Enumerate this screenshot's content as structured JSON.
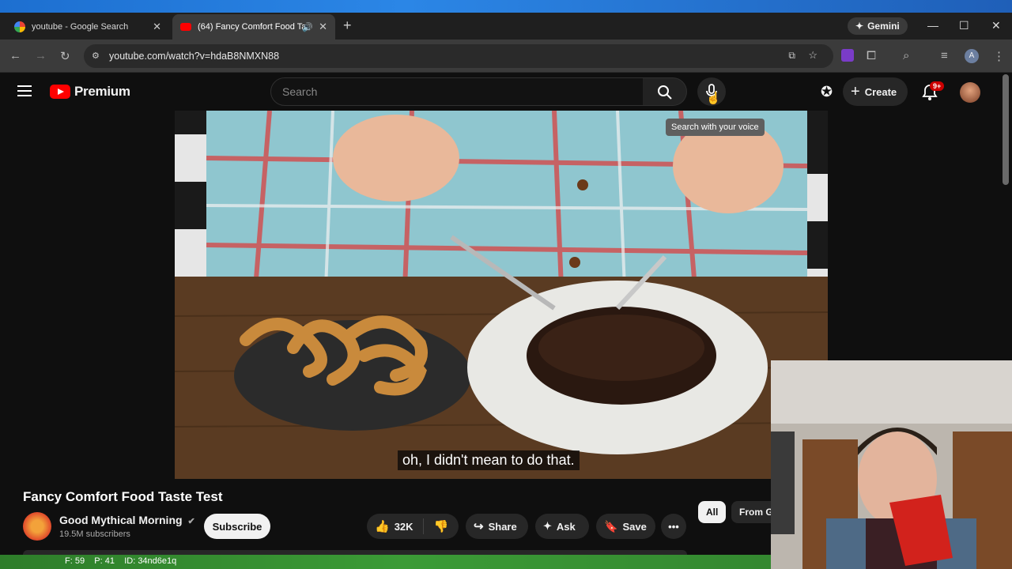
{
  "browser": {
    "tabs": [
      {
        "title": "youtube - Google Search",
        "active": false
      },
      {
        "title": "(64) Fancy Comfort Food Ta",
        "active": true
      }
    ],
    "gemini_label": "Gemini",
    "url": "youtube.com/watch?v=hdaB8NMXN88",
    "profile_initial": "A"
  },
  "youtube": {
    "logo_text": "Premium",
    "search_placeholder": "Search",
    "mic_tooltip": "Search with your voice",
    "create_label": "Create",
    "notification_count": "9+",
    "video": {
      "subtitle": "oh, I didn't mean to do that.",
      "title": "Fancy Comfort Food Taste Test"
    },
    "channel": {
      "name": "Good Mythical Morning",
      "subscribers": "19.5M subscribers",
      "subscribe_label": "Subscribe"
    },
    "actions": {
      "likes": "32K",
      "share": "Share",
      "ask": "Ask",
      "save": "Save"
    },
    "chips": [
      "All",
      "From G"
    ]
  },
  "overlay": {
    "debug_text": "F: 59    P: 41    ID: 34nd6e1q"
  },
  "colors": {
    "yt_red": "#ff0000",
    "background": "#0f0f0f"
  }
}
